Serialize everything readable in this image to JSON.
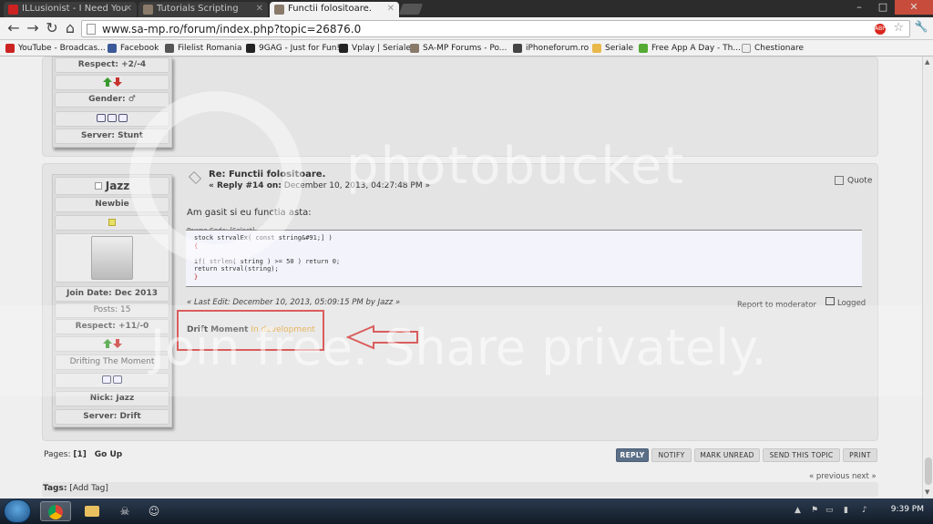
{
  "browser": {
    "tabs": [
      {
        "title": "ILLusionist - I Need You",
        "favicon_color": "#cc2222"
      },
      {
        "title": "Tutorials Scripting",
        "favicon_color": "#8a7a6a"
      },
      {
        "title": "Functii folositoare.",
        "favicon_color": "#8a7a6a",
        "active": true
      }
    ],
    "url": "www.sa-mp.ro/forum/index.php?topic=26876.0",
    "window_controls": {
      "minimize": "–",
      "maximize": "□",
      "close": "✕"
    }
  },
  "bookmarks": [
    {
      "label": "YouTube - Broadcas...",
      "color": "#cc2222"
    },
    {
      "label": "Facebook",
      "color": "#3b5998"
    },
    {
      "label": "Filelist Romania",
      "color": "#555555"
    },
    {
      "label": "9GAG - Just for Fun!",
      "color": "#222222"
    },
    {
      "label": "Vplay | Seriale",
      "color": "#222222"
    },
    {
      "label": "SA-MP Forums - Po...",
      "color": "#8a7a6a"
    },
    {
      "label": "iPhoneforum.ro",
      "color": "#444444"
    },
    {
      "label": "Seriale",
      "color": "#e8b84a"
    },
    {
      "label": "Free App A Day - Th...",
      "color": "#55aa33"
    },
    {
      "label": "Chestionare",
      "color": "#eeeeee"
    }
  ],
  "prev_profile": {
    "respect": "Respect: +2/-4",
    "gender": "Gender: ♂",
    "server": "Server: Stunt"
  },
  "post": {
    "username": "Jazz",
    "rank": "Newbie",
    "join_date": "Join Date: Dec 2013",
    "posts": "Posts: 15",
    "respect": "Respect: +11/-0",
    "custom_title": "Drifting The Moment",
    "nick": "Nick: Jazz",
    "server": "Server: Drift",
    "title": "Re: Functii folositoare.",
    "meta_prefix": "« Reply #14 on:",
    "meta_date": "December 10, 2013, 04:27:48 PM »",
    "quote": "Quote",
    "body": "Am gasit si eu functia asta:",
    "code_label": "Pawno Code: [Select]",
    "code_lines": [
      "stock strvalEx( const string&#91;] )",
      "{",
      "",
      "    if( strlen( string ) >= 50 ) return 0;",
      "    return strval(string);",
      "}"
    ],
    "last_edit": "« Last Edit: December 10, 2013, 05:09:15 PM by Jazz »",
    "report": "Report to moderator",
    "logged": "Logged",
    "sig_drift": "Drift",
    "sig_moment": "Moment",
    "sig_dev": "In development"
  },
  "pagination": {
    "pages_label": "Pages:",
    "current": "[1]",
    "go_up": "Go Up"
  },
  "actions": [
    "REPLY",
    "NOTIFY",
    "MARK UNREAD",
    "SEND THIS TOPIC",
    "PRINT"
  ],
  "nav": "« previous next »",
  "tags": {
    "label": "Tags:",
    "add": "[Add Tag]"
  },
  "watermark": {
    "line1": "photobucket",
    "line2": "Join free. Share privately."
  },
  "taskbar": {
    "clock": "9:39 PM"
  }
}
